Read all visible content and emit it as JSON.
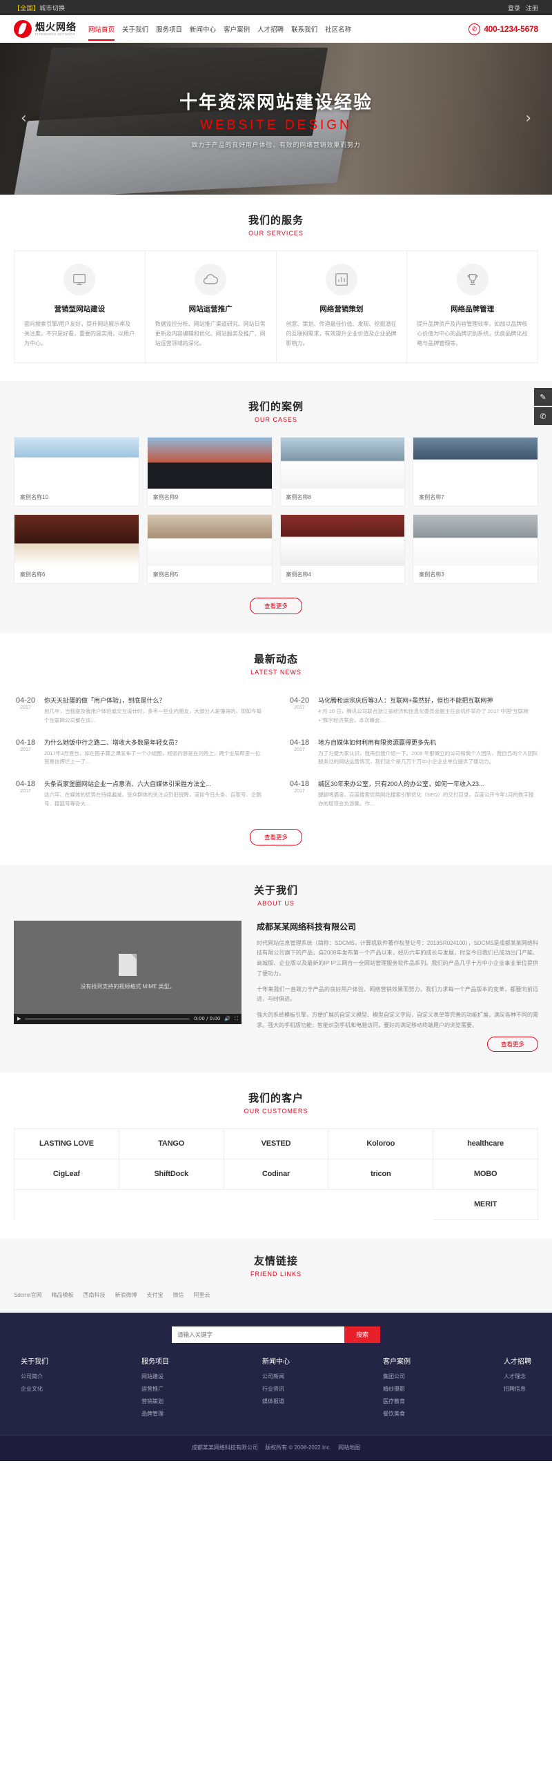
{
  "topbar": {
    "region_tag": "【全国】",
    "region_label": "城市切换",
    "login": "登录",
    "register": "注册"
  },
  "header": {
    "logo_cn": "烟火网络",
    "logo_en": "FIREWORKS NETWORK",
    "nav": [
      {
        "label": "网站首页",
        "active": true
      },
      {
        "label": "关于我们",
        "active": false
      },
      {
        "label": "服务项目",
        "active": false
      },
      {
        "label": "新闻中心",
        "active": false
      },
      {
        "label": "客户案例",
        "active": false
      },
      {
        "label": "人才招聘",
        "active": false
      },
      {
        "label": "联系我们",
        "active": false
      },
      {
        "label": "社区名称",
        "active": false
      }
    ],
    "phone": "400-1234-5678"
  },
  "hero": {
    "title": "十年资深网站建设经验",
    "subtitle": "WEBSITE DESIGN",
    "desc": "致力于产品的良好用户体验、有效的网络营销效果而努力",
    "prev": "‹",
    "next": "›"
  },
  "dock": [
    {
      "name": "feedback",
      "glyph": "✎"
    },
    {
      "name": "phone",
      "glyph": "✆"
    }
  ],
  "services": {
    "title": "我们的服务",
    "subtitle": "OUR SERVICES",
    "items": [
      {
        "icon": "monitor-icon",
        "title": "营销型网站建设",
        "desc": "面向搜索引擎/用户友好，提升网站展示率及关注度。不只是好看，重要的是实用，以用户为中心。"
      },
      {
        "icon": "cloud-icon",
        "title": "网站运营推广",
        "desc": "数据监控分析、网站推广渠道研究、网站日常更新及内容编辑和优化、网站服务及推广、网站运营领域的深化。"
      },
      {
        "icon": "chart-icon",
        "title": "网络营销策划",
        "desc": "创意、策划、传递最佳价值、发现、挖掘潜在的互联网需求，有效提升企业价值及企业品牌影响力。"
      },
      {
        "icon": "trophy-icon",
        "title": "网络品牌管理",
        "desc": "提升品牌资产及内容管理效率，如加以品牌核心价值为中心的品牌识别系统，优良品牌化战略与品牌管理等。"
      }
    ]
  },
  "cases": {
    "title": "我们的案例",
    "subtitle": "OUR CASES",
    "more": "查看更多",
    "items": [
      {
        "caption": "案例名称10",
        "theme": "bridge-blue"
      },
      {
        "caption": "案例名称9",
        "theme": "bridge-red"
      },
      {
        "caption": "案例名称8",
        "theme": "building"
      },
      {
        "caption": "案例名称7",
        "theme": "mountain"
      },
      {
        "caption": "案例名称6",
        "theme": "food"
      },
      {
        "caption": "案例名称5",
        "theme": "people"
      },
      {
        "caption": "案例名称4",
        "theme": "bathroom"
      },
      {
        "caption": "案例名称3",
        "theme": "campus"
      }
    ]
  },
  "news": {
    "title": "最新动态",
    "subtitle": "LATEST NEWS",
    "more": "查看更多",
    "left": [
      {
        "day": "04-20",
        "year": "2017",
        "title": "你天天扯蛋的做「用户体验」，到底是什么？",
        "summary": "前几年，当我提及我用户体验或交互设计时，多半一些业内朋友，大部分人是懂得的，现如今每个互联网公司都在谈..."
      },
      {
        "day": "04-18",
        "year": "2017",
        "title": "为什么她饭中行之路二、增收大多数是年轻女员？",
        "summary": "2017年3月首台，如在图子算之课发布了一个小组图，经验内容是在刘姓上，两个业局帮里一位贸易信辉烂上一了..."
      },
      {
        "day": "04-18",
        "year": "2017",
        "title": "头条百家堡圈网站企业一点意消、六大自媒体引采胜方法全...",
        "summary": "这六年、在媒体的优势在持续遍减、受众群体的关注点仍旧锐降，道如今日头条、百家号、企鹅号、搜狐号等各大..."
      }
    ],
    "right": [
      {
        "day": "04-20",
        "year": "2017",
        "title": "马化腾和运宗庆后等3人：互联网+虽然好，但也不能把互联网神",
        "summary": "4 月 20 日，腾讯公司联合浙江省经济和信息化委员会副主任会机件举办了 2017 中国\"互联网+\"数字经济案会。本次峰会..."
      },
      {
        "day": "04-18",
        "year": "2017",
        "title": "地方自媒体如何利用有限资源赢得更多先机",
        "summary": "为了方便大家认识，我再自我介绍一下。2009 年那做立的公司和我个人团队，我自己的个人团队服务过的网站运营情况，我们这个是几万十万中小企业业单位提供了便功力。"
      },
      {
        "day": "04-18",
        "year": "2017",
        "title": "缄区30年来办公室，只有200人的办公室，如何一年收入23...",
        "summary": "腿脚啤酒滚、百度搜索优势网站搜索引擎优化（SEO）的交付目录，百度公开今年1月的数字报亦的增现会负游集。作..."
      }
    ]
  },
  "about": {
    "title": "关于我们",
    "subtitle": "ABOUT US",
    "video_message": "没有找到支持的视频格式 MIME 类型。",
    "video_time": "0:00 / 0:00",
    "company": "成都某某网络科技有限公司",
    "paragraphs": [
      "时代网站信息管理系统（简称：SDCMS，计算机软件著作权登记号：2013SR024100），SDCMS是成都某某网络科技有限公司旗下的产品，自2008年发布第一个产品以来，经历六年的成长与发展，时至今日我们已成功出门产能、商城版、企业版以及最新的IP IP三网合一全网站管理服务软件品系列。我们的产品几乎十万中小企业事业单位提供了便功力。",
      "十年来我们一直致力于产品的良好用户体验、网络营销效果而努力，我们力求每一个产品版本的变革，都要向前迈进，与时俱进。",
      "强大的系统模板引擎，方便扩展的自定义模型、模型自定义字段，自定义表单等完善的功能扩展，满足各种不同的需求。强大的手机版功能，智能识别手机和电脑访问，要好的满足移动终端用户的浏览需要。"
    ],
    "more": "查看更多"
  },
  "customers": {
    "title": "我们的客户",
    "subtitle": "OUR CUSTOMERS",
    "logos": [
      "LASTING LOVE",
      "TANGO",
      "VESTED",
      "Koloroo",
      "healthcare",
      "CigLeaf",
      "ShiftDock",
      "Codinar",
      "tricon",
      "MOBO"
    ],
    "logos_row1": [
      "LASTING LOVE",
      "TANGO",
      "VESTED",
      "Koloroo",
      "healthcare"
    ],
    "logos_row2": [
      "CigLeaf",
      "ShiftDock",
      "Codinar",
      "tricon",
      "MOBO"
    ],
    "logo_extra": "MERIT"
  },
  "friendlinks": {
    "title": "友情链接",
    "subtitle": "FRIEND LINKS",
    "items": [
      "Sdcms官网",
      "精品模板",
      "西南科技",
      "新浪微博",
      "支付宝",
      "微信",
      "阿里云"
    ]
  },
  "footer": {
    "search_placeholder": "请输入关键字",
    "search_button": "搜索",
    "columns": [
      {
        "title": "关于我们",
        "links": [
          "公司简介",
          "企业文化"
        ]
      },
      {
        "title": "服务项目",
        "links": [
          "网站建设",
          "运营推广",
          "营销策划",
          "品牌管理"
        ]
      },
      {
        "title": "新闻中心",
        "links": [
          "公司新闻",
          "行业资讯",
          "媒体报道"
        ]
      },
      {
        "title": "客户案例",
        "links": [
          "集团公司",
          "婚纱摄影",
          "医疗教育",
          "餐饮美食"
        ]
      },
      {
        "title": "人才招聘",
        "links": [
          "人才理念",
          "招聘信息"
        ]
      }
    ],
    "copyright": "成都某某网络科技有限公司",
    "copyright_rights": "版权所有 © 2008-2022 Inc.",
    "sitemap": "网站地图"
  },
  "colors": {
    "brand_red": "#e60012",
    "footer_navy": "#242444",
    "topbar_dark": "#2f2f2f"
  }
}
